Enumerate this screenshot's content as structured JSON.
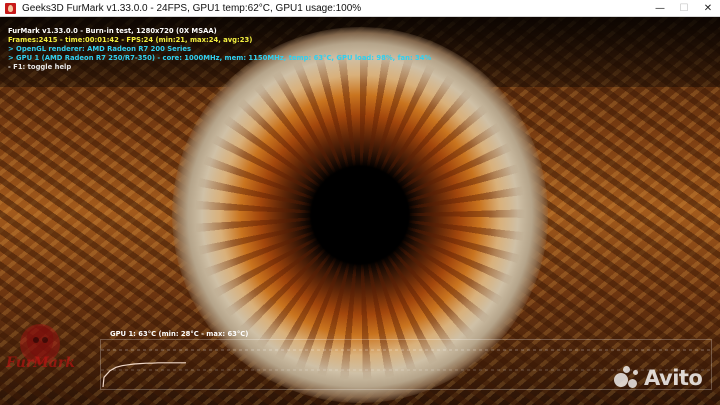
{
  "window": {
    "title": "Geeks3D FurMark v1.33.0.0 - 24FPS, GPU1 temp:62°C, GPU1 usage:100%",
    "minimize_glyph": "—",
    "restore_glyph": "☐",
    "close_glyph": "✕"
  },
  "osd": {
    "line1": "FurMark v1.33.0.0 - Burn-in test, 1280x720 (0X MSAA)",
    "line2": "Frames:2415 - time:00:01:42 - FPS:24 (min:21, max:24, avg:23)",
    "line3": "> OpenGL renderer: AMD Radeon R7 200 Series",
    "line4": "> GPU 1 (AMD Radeon R7 250/R7-350) - core: 1000MHz, mem: 1150MHz, temp: 63°C, GPU load: 98%, fan: 34%",
    "line5": "- F1: toggle help"
  },
  "graph": {
    "label": "GPU 1: 63°C (min: 28°C - max: 63°C)",
    "temperature_samples_c": [
      28,
      44,
      52,
      56,
      58,
      60,
      61,
      62,
      62,
      63,
      63,
      63
    ]
  },
  "logo": {
    "text": "FurMark"
  },
  "watermark": {
    "text": "Avito"
  },
  "colors": {
    "osd_title": "#ffffff",
    "osd_stats": "#f4f040",
    "osd_gpu": "#31d0f0",
    "graph_line": "#f0d8c8"
  }
}
